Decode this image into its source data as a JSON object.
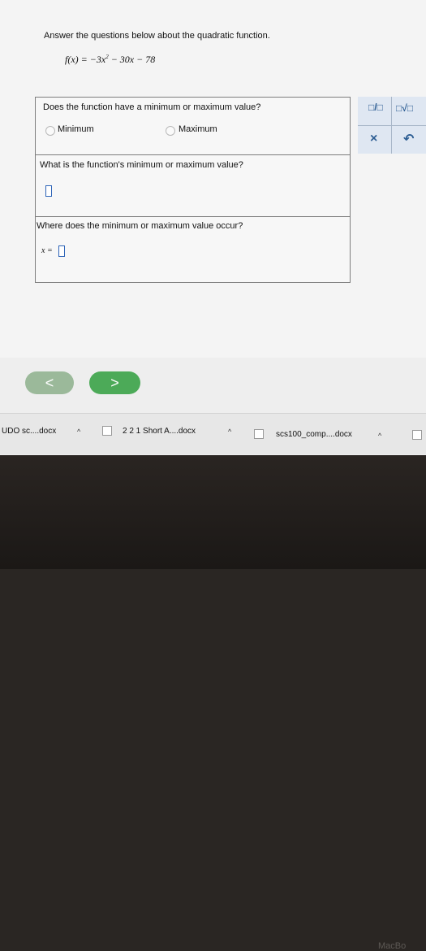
{
  "prompt": "Answer the questions below about the quadratic function.",
  "function": {
    "lhs": "f(x) = −3x",
    "exponent": "2",
    "rhs": " − 30x − 78"
  },
  "questions": [
    {
      "text": "Does the function have a minimum or maximum value?",
      "options": [
        "Minimum",
        "Maximum"
      ]
    },
    {
      "text": "What is the function's minimum or maximum value?"
    },
    {
      "text": "Where does the minimum or maximum value occur?",
      "prefix": "x ="
    }
  ],
  "tools": {
    "fraction": "□/□",
    "sqrt": "□√□",
    "clear": "×",
    "undo": "↶"
  },
  "nav": {
    "back": "<",
    "next": ">"
  },
  "downloads": [
    {
      "label": "UDO sc....docx",
      "caret": "^"
    },
    {
      "label": "2 2 1 Short A....docx",
      "caret": "^"
    },
    {
      "label": "scs100_comp....docx",
      "caret": "^"
    }
  ],
  "brand": "MacBo",
  "colors": {
    "accent": "#2f65b8",
    "next_button": "#4caa58",
    "back_button": "#9bb99a"
  }
}
